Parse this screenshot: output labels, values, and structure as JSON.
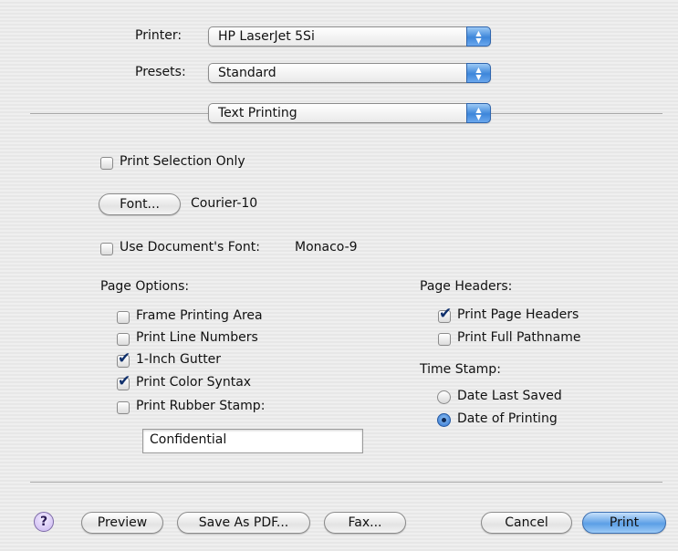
{
  "printer": {
    "label": "Printer:",
    "value": "HP LaserJet 5Si"
  },
  "presets": {
    "label": "Presets:",
    "value": "Standard"
  },
  "panel": {
    "value": "Text Printing"
  },
  "print_selection_only": {
    "label": "Print Selection Only",
    "checked": false
  },
  "font": {
    "button": "Font...",
    "value": "Courier-10"
  },
  "use_document_font": {
    "label": "Use Document's Font:",
    "font": "Monaco-9",
    "checked": false
  },
  "page_options": {
    "title": "Page Options:",
    "items": [
      {
        "label": "Frame Printing Area",
        "checked": false
      },
      {
        "label": "Print Line Numbers",
        "checked": false
      },
      {
        "label": "1-Inch Gutter",
        "checked": true
      },
      {
        "label": "Print Color Syntax",
        "checked": true
      },
      {
        "label": "Print Rubber Stamp:",
        "checked": false
      }
    ],
    "stamp_text": "Confidential"
  },
  "page_headers": {
    "title": "Page Headers:",
    "items": [
      {
        "label": "Print Page Headers",
        "checked": true
      },
      {
        "label": "Print Full Pathname",
        "checked": false
      }
    ]
  },
  "time_stamp": {
    "title": "Time Stamp:",
    "options": [
      {
        "label": "Date Last Saved",
        "selected": false
      },
      {
        "label": "Date of Printing",
        "selected": true
      }
    ]
  },
  "buttons": {
    "help": "?",
    "preview": "Preview",
    "save_pdf": "Save As PDF...",
    "fax": "Fax...",
    "cancel": "Cancel",
    "print": "Print"
  },
  "icons": {
    "checkmark": "✔",
    "popup_arrows": "▲▼"
  }
}
